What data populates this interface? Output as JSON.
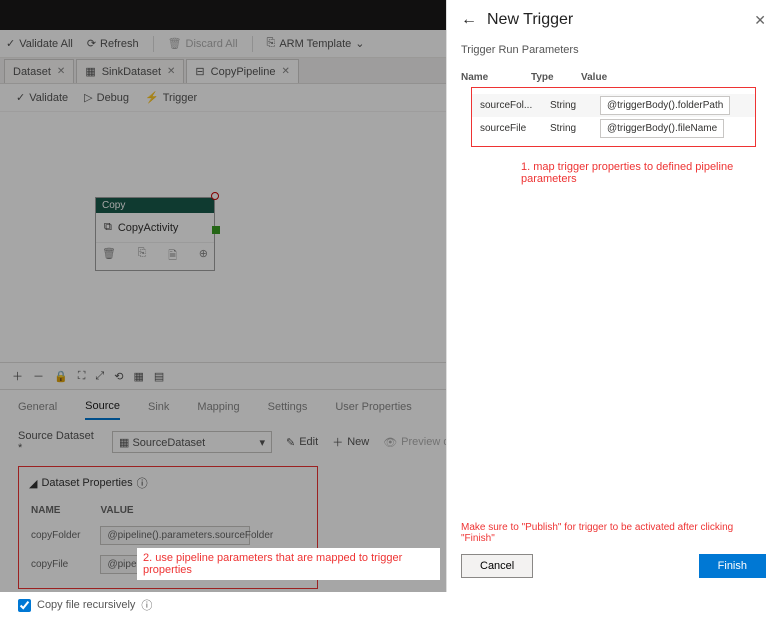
{
  "actionbar": {
    "validate_all": "Validate All",
    "refresh": "Refresh",
    "discard_all": "Discard All",
    "arm_template": "ARM Template"
  },
  "tabs": [
    {
      "label": "Dataset"
    },
    {
      "label": "SinkDataset"
    },
    {
      "label": "CopyPipeline"
    }
  ],
  "canvas_toolbar": {
    "validate": "Validate",
    "debug": "Debug",
    "trigger": "Trigger"
  },
  "activity": {
    "header": "Copy",
    "name": "CopyActivity"
  },
  "subtabs": {
    "general": "General",
    "source": "Source",
    "sink": "Sink",
    "mapping": "Mapping",
    "settings": "Settings",
    "user_properties": "User Properties"
  },
  "source": {
    "label": "Source Dataset *",
    "value": "SourceDataset",
    "edit": "Edit",
    "new": "New",
    "preview": "Preview data"
  },
  "dataset_props": {
    "title": "Dataset Properties",
    "name_col": "NAME",
    "value_col": "VALUE",
    "rows": [
      {
        "name": "copyFolder",
        "value": "@pipeline().parameters.sourceFolder"
      },
      {
        "name": "copyFile",
        "value": "@pipeline().parameters.sourceFile"
      }
    ]
  },
  "recursive": {
    "label": "Copy file recursively"
  },
  "annotations": {
    "a1": "1. map trigger properties to defined pipeline parameters",
    "a2": "2. use pipeline parameters that are mapped to trigger properties"
  },
  "panel": {
    "title": "New Trigger",
    "section": "Trigger Run Parameters",
    "cols": {
      "name": "Name",
      "type": "Type",
      "value": "Value"
    },
    "rows": [
      {
        "name": "sourceFol...",
        "type": "String",
        "value": "@triggerBody().folderPath"
      },
      {
        "name": "sourceFile",
        "type": "String",
        "value": "@triggerBody().fileName"
      }
    ],
    "publish_note": "Make sure to \"Publish\" for trigger to be activated after clicking \"Finish\"",
    "cancel": "Cancel",
    "finish": "Finish"
  }
}
